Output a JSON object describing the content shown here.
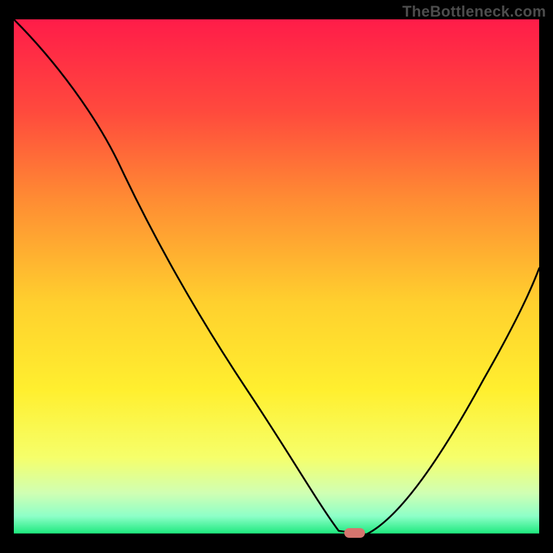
{
  "watermark": "TheBottleneck.com",
  "chart_data": {
    "type": "line",
    "title": "",
    "xlabel": "",
    "ylabel": "",
    "xlim": [
      0,
      100
    ],
    "ylim": [
      0,
      100
    ],
    "grid": false,
    "legend": false,
    "background": {
      "type": "vertical-gradient",
      "stops": [
        {
          "pos": 0.0,
          "color": "#ff1c49"
        },
        {
          "pos": 0.18,
          "color": "#ff4a3d"
        },
        {
          "pos": 0.35,
          "color": "#ff8c33"
        },
        {
          "pos": 0.55,
          "color": "#ffd02e"
        },
        {
          "pos": 0.72,
          "color": "#ffef2f"
        },
        {
          "pos": 0.85,
          "color": "#f6ff6a"
        },
        {
          "pos": 0.92,
          "color": "#d0ffb3"
        },
        {
          "pos": 0.965,
          "color": "#8dffc8"
        },
        {
          "pos": 1.0,
          "color": "#18e87a"
        }
      ]
    },
    "series": [
      {
        "name": "bottleneck-curve",
        "x": [
          0,
          6,
          12,
          18,
          24,
          30,
          36,
          42,
          48,
          54,
          59,
          62,
          64,
          66,
          72,
          80,
          88,
          96,
          100
        ],
        "y": [
          100,
          94,
          87,
          80,
          73,
          64,
          55,
          45,
          35,
          24,
          12,
          4,
          0,
          0,
          4,
          18,
          34,
          50,
          58
        ]
      }
    ],
    "marker": {
      "name": "optimal-point",
      "shape": "pill",
      "x": 65,
      "y": 0,
      "color": "#d6756e"
    }
  }
}
